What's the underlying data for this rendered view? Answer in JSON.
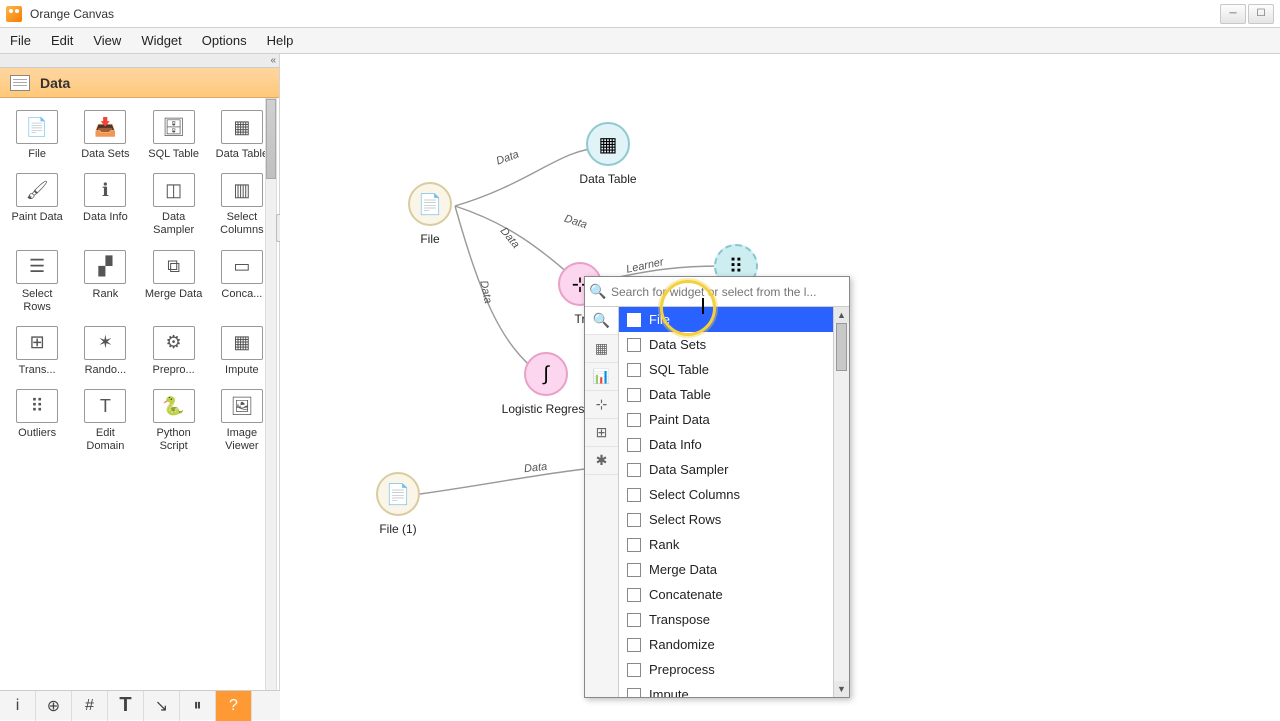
{
  "app": {
    "title": "Orange Canvas"
  },
  "menu": [
    "File",
    "Edit",
    "View",
    "Widget",
    "Options",
    "Help"
  ],
  "sidebar": {
    "category": "Data",
    "widgets": [
      {
        "label": "File",
        "icon": "📄"
      },
      {
        "label": "Data Sets",
        "icon": "📥"
      },
      {
        "label": "SQL Table",
        "icon": "🗄"
      },
      {
        "label": "Data Table",
        "icon": "▦"
      },
      {
        "label": "Paint Data",
        "icon": "🖌"
      },
      {
        "label": "Data Info",
        "icon": "ℹ"
      },
      {
        "label": "Data Sampler",
        "icon": "◫"
      },
      {
        "label": "Select Columns",
        "icon": "▥"
      },
      {
        "label": "Select Rows",
        "icon": "☰"
      },
      {
        "label": "Rank",
        "icon": "▞"
      },
      {
        "label": "Merge Data",
        "icon": "⧉"
      },
      {
        "label": "Conca...",
        "icon": "▭"
      },
      {
        "label": "Trans...",
        "icon": "⊞"
      },
      {
        "label": "Rando...",
        "icon": "✶"
      },
      {
        "label": "Prepro...",
        "icon": "⚙"
      },
      {
        "label": "Impute",
        "icon": "▦"
      },
      {
        "label": "Outliers",
        "icon": "⠿"
      },
      {
        "label": "Edit Domain",
        "icon": "T"
      },
      {
        "label": "Python Script",
        "icon": "🐍"
      },
      {
        "label": "Image Viewer",
        "icon": "🖼"
      }
    ]
  },
  "canvas": {
    "nodes": {
      "file": "File",
      "file1": "File (1)",
      "datatable": "Data Table",
      "tree": "Tr",
      "log": "Logistic Regress",
      "test": ""
    },
    "edges": {
      "d1": "Data",
      "d2": "Data",
      "d3": "Data",
      "d4": "Data",
      "d5": "Data",
      "learner": "Learner"
    }
  },
  "popup": {
    "placeholder": "Search for widget or select from the l...",
    "items": [
      "File",
      "Data Sets",
      "SQL Table",
      "Data Table",
      "Paint Data",
      "Data Info",
      "Data Sampler",
      "Select Columns",
      "Select Rows",
      "Rank",
      "Merge Data",
      "Concatenate",
      "Transpose",
      "Randomize",
      "Preprocess",
      "Impute"
    ]
  }
}
